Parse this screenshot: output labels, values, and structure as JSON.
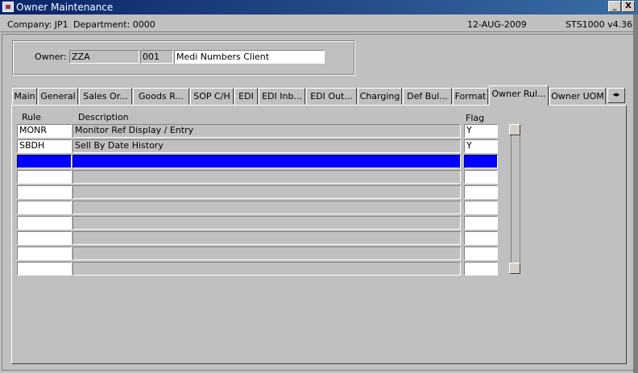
{
  "window": {
    "title": "Owner Maintenance",
    "minimize_label": "_",
    "close_label": "X"
  },
  "infobar": {
    "company": "Company:  JP1",
    "department": "Department:  0000",
    "date": "12-AUG-2009",
    "version": "STS1000  v4.36"
  },
  "owner": {
    "label": "Owner:",
    "code": "ZZA",
    "number": "001",
    "name": "Medi Numbers Client"
  },
  "tabs": [
    {
      "label": "Main"
    },
    {
      "label": "General"
    },
    {
      "label": "Sales Or..."
    },
    {
      "label": "Goods R..."
    },
    {
      "label": "SOP C/H"
    },
    {
      "label": "EDI"
    },
    {
      "label": "EDI Inb..."
    },
    {
      "label": "EDI Out..."
    },
    {
      "label": "Charging"
    },
    {
      "label": "Def Bul..."
    },
    {
      "label": "Format"
    },
    {
      "label": "Owner Rul..."
    },
    {
      "label": "Owner UOM"
    }
  ],
  "tab_scroll_label": "◂▸",
  "grid": {
    "headers": {
      "rule": "Rule",
      "description": "Description",
      "flag": "Flag"
    },
    "rows": [
      {
        "rule": "MONR",
        "description": "Monitor Ref Display / Entry",
        "flag": "Y"
      },
      {
        "rule": "SBDH",
        "description": "Sell By Date History",
        "flag": "Y"
      },
      {
        "rule": "",
        "description": "",
        "flag": ""
      },
      {
        "rule": "",
        "description": "",
        "flag": ""
      },
      {
        "rule": "",
        "description": "",
        "flag": ""
      },
      {
        "rule": "",
        "description": "",
        "flag": ""
      },
      {
        "rule": "",
        "description": "",
        "flag": ""
      },
      {
        "rule": "",
        "description": "",
        "flag": ""
      },
      {
        "rule": "",
        "description": "",
        "flag": ""
      },
      {
        "rule": "",
        "description": "",
        "flag": ""
      }
    ]
  }
}
